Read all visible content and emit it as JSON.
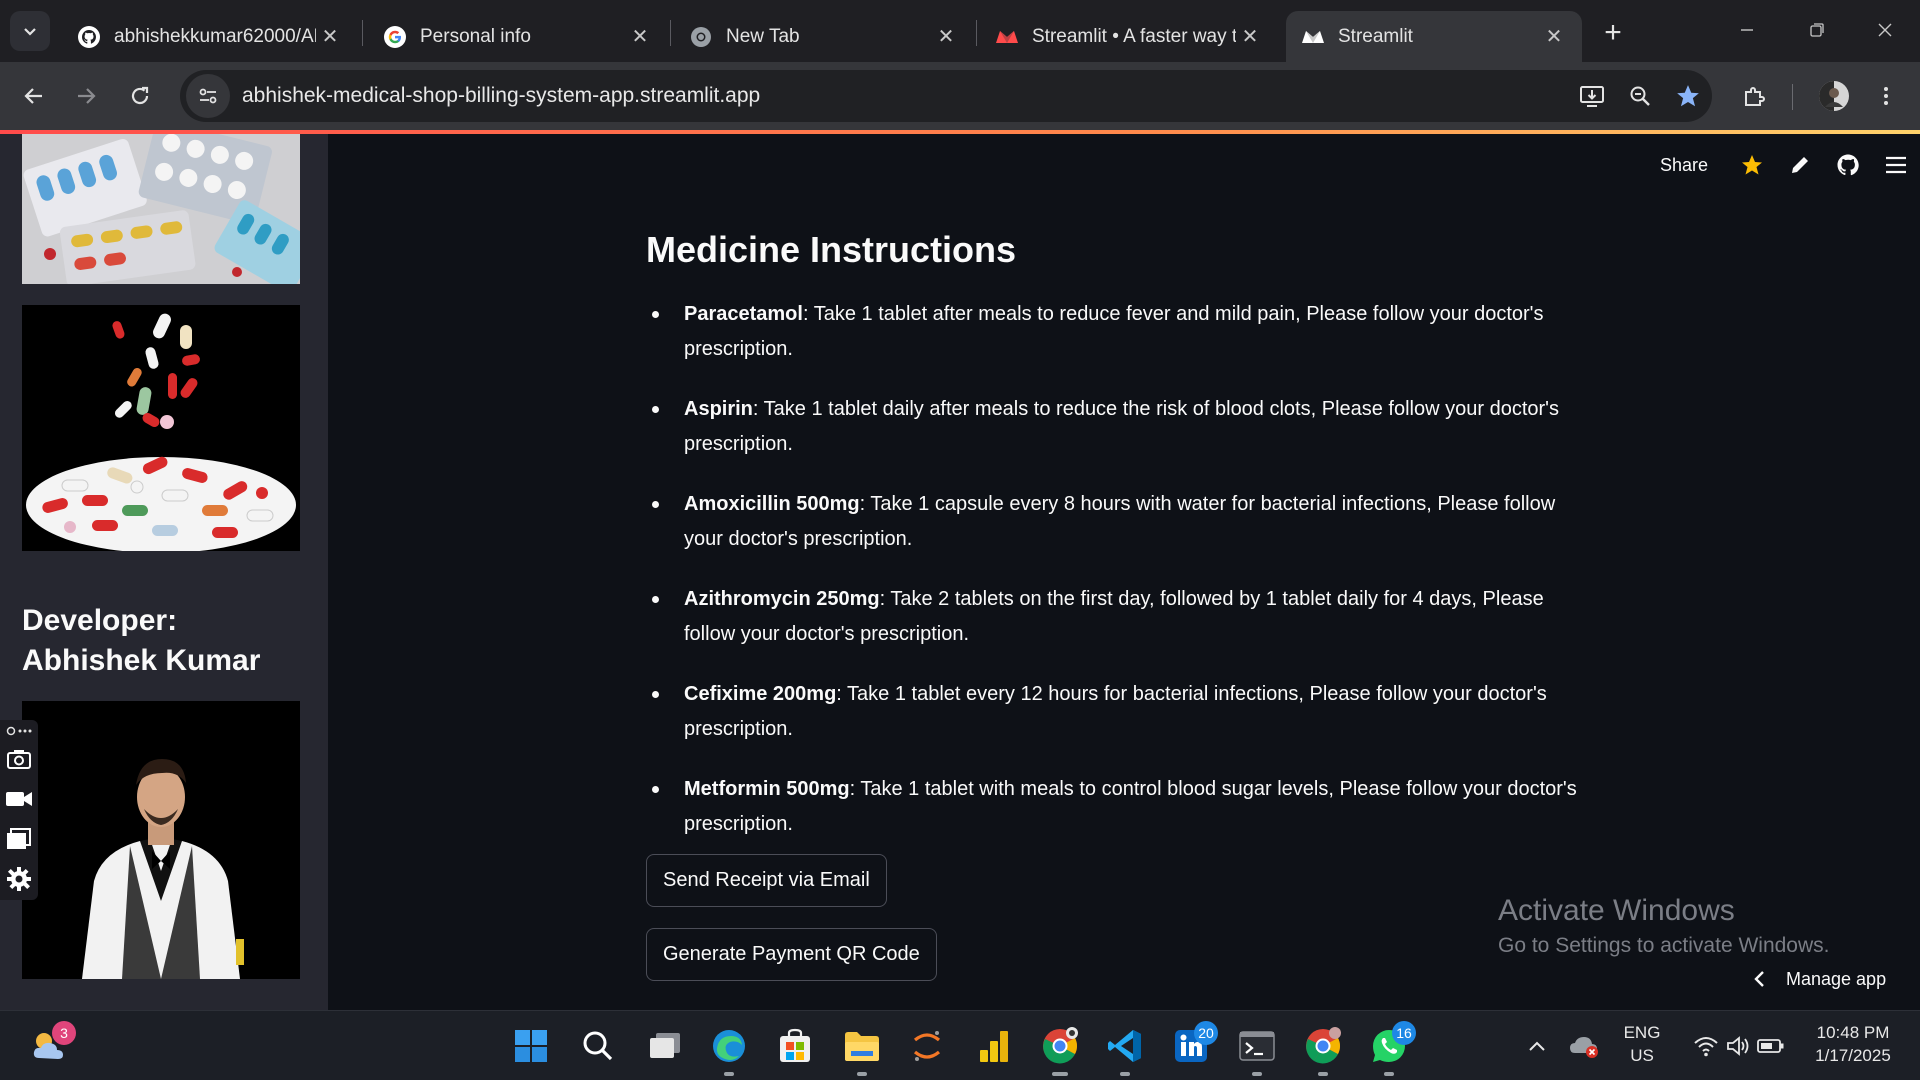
{
  "browser": {
    "tabs": [
      {
        "title": "abhishekkumar62000/AB",
        "icon": "github-icon"
      },
      {
        "title": "Personal info",
        "icon": "google-icon"
      },
      {
        "title": "New Tab",
        "icon": "chrome-icon"
      },
      {
        "title": "Streamlit • A faster way t",
        "icon": "streamlit-icon"
      },
      {
        "title": "Streamlit",
        "icon": "streamlit-icon"
      }
    ],
    "url": "abhishek-medical-shop-billing-system-app.streamlit.app"
  },
  "app": {
    "share_label": "Share",
    "sidebar": {
      "developer_heading": "Developer: Abhishek Kumar"
    },
    "heading": "Medicine Instructions",
    "instructions": [
      {
        "name": "Paracetamol",
        "text": ": Take 1 tablet after meals to reduce fever and mild pain, Please follow your doctor's prescription."
      },
      {
        "name": "Aspirin",
        "text": ": Take 1 tablet daily after meals to reduce the risk of blood clots, Please follow your doctor's prescription."
      },
      {
        "name": "Amoxicillin 500mg",
        "text": ": Take 1 capsule every 8 hours with water for bacterial infections, Please follow your doctor's prescription."
      },
      {
        "name": "Azithromycin 250mg",
        "text": ": Take 2 tablets on the first day, followed by 1 tablet daily for 4 days, Please follow your doctor's prescription."
      },
      {
        "name": "Cefixime 200mg",
        "text": ": Take 1 tablet every 12 hours for bacterial infections, Please follow your doctor's prescription."
      },
      {
        "name": "Metformin 500mg",
        "text": ": Take 1 tablet with meals to control blood sugar levels, Please follow your doctor's prescription."
      }
    ],
    "buttons": {
      "send_receipt": "Send Receipt via Email",
      "generate_qr": "Generate Payment QR Code"
    },
    "manage_app": "Manage app"
  },
  "watermark": {
    "line1": "Activate Windows",
    "line2": "Go to Settings to activate Windows."
  },
  "taskbar": {
    "weather_badge": "3",
    "linkedin_badge": "20",
    "whatsapp_badge": "16",
    "lang_line1": "ENG",
    "lang_line2": "US",
    "time": "10:48 PM",
    "date": "1/17/2025"
  },
  "colors": {
    "accent": "#ff4b4b",
    "sidebar_bg": "#262730",
    "main_bg": "#0e1117",
    "star": "#fbbc04",
    "bookmark_star": "#8ab4f8"
  }
}
